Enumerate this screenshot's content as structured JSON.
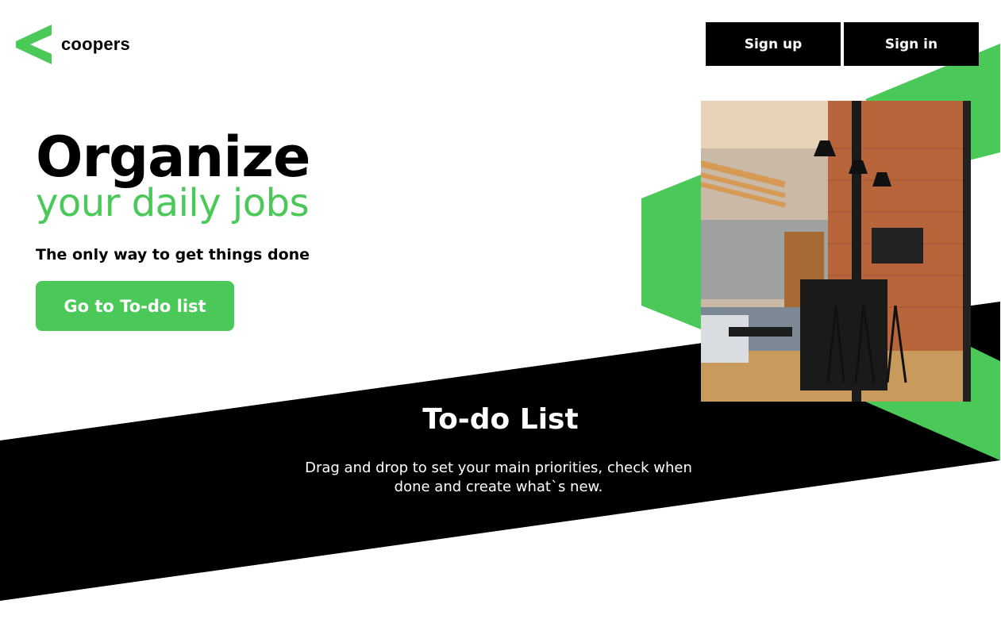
{
  "brand": {
    "name": "coopers",
    "logo_icon": "chevron-left-logo-icon"
  },
  "nav": {
    "signup_label": "Sign up",
    "signin_label": "Sign in"
  },
  "hero": {
    "title": "Organize",
    "subtitle": "your daily jobs",
    "tagline": "The only way to get things done",
    "cta_label": "Go to To-do list",
    "image": "office-interior-photo"
  },
  "todo_section": {
    "title": "To-do List",
    "description": "Drag and drop to set your main priorities, check when done and create what`s new."
  },
  "colors": {
    "accent": "#4ac959",
    "dark": "#000000",
    "background": "#ffffff"
  }
}
